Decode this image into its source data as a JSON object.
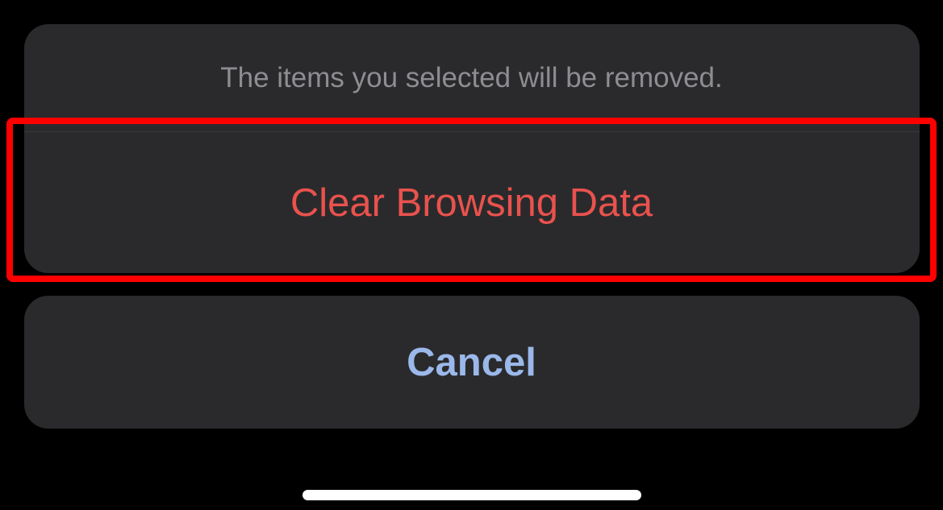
{
  "actionSheet": {
    "message": "The items you selected will be removed.",
    "destructiveAction": "Clear Browsing Data",
    "cancelAction": "Cancel"
  }
}
